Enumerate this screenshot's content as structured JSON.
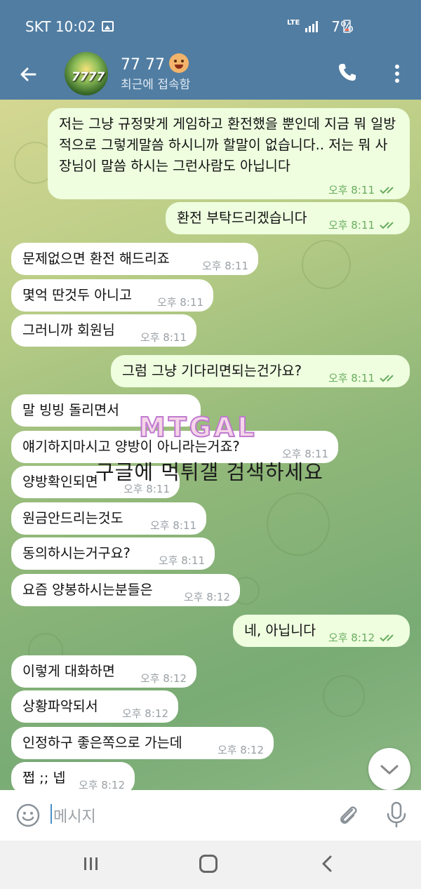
{
  "status_bar": {
    "carrier_time": "SKT 10:02",
    "network": "LTE",
    "battery": "7%"
  },
  "header": {
    "contact_name": "77 77",
    "status": "최근에 접속함",
    "avatar_text": "7777"
  },
  "messages": [
    {
      "dir": "out",
      "text": "저는 그냥 규정맞게 게임하고 환전했을 뿐인데 지금 뭐 일방적으로 그렇게말씀 하시니까 할말이 없습니다.. 저는 뭐 사장님이 말씀 하시는 그런사람도 아닙니다",
      "time": "오후 8:11"
    },
    {
      "dir": "out",
      "text": "환전 부탁드리겠습니다",
      "time": "오후 8:11"
    },
    {
      "dir": "in",
      "text": "문제없으면 환전 해드리죠",
      "time": "오후 8:11"
    },
    {
      "dir": "in",
      "text": "몇억 딴것두 아니고",
      "time": "오후 8:11"
    },
    {
      "dir": "in",
      "text": "그러니까 회원님",
      "time": "오후 8:11"
    },
    {
      "dir": "out",
      "text": "그럼 그냥 기다리면되는건가요?",
      "time": "오후 8:11"
    },
    {
      "dir": "in",
      "text": "말 빙빙 돌리면서",
      "time": ""
    },
    {
      "dir": "in",
      "text": "얘기하지마시고 양방이 아니라는거죠?",
      "time": "오후 8:11"
    },
    {
      "dir": "in",
      "text": "양방확인되면",
      "time": "오후 8:11"
    },
    {
      "dir": "in",
      "text": "원금안드리는것도",
      "time": "오후 8:11"
    },
    {
      "dir": "in",
      "text": "동의하시는거구요?",
      "time": "오후 8:11"
    },
    {
      "dir": "in",
      "text": "요즘 양봉하시는분들은",
      "time": "오후 8:12"
    },
    {
      "dir": "out",
      "text": "네, 아닙니다",
      "time": "오후 8:12"
    },
    {
      "dir": "in",
      "text": "이렇게 대화하면",
      "time": "오후 8:12"
    },
    {
      "dir": "in",
      "text": "상황파악되서",
      "time": "오후 8:12"
    },
    {
      "dir": "in",
      "text": "인정하구 좋은쪽으로 가는데",
      "time": "오후 8:12"
    },
    {
      "dir": "in",
      "text": "쩝 ;; 넵",
      "time": "오후 8:12"
    }
  ],
  "watermark": {
    "logo": "MTGAL",
    "text": "구글에 먹튀갤 검색하세요"
  },
  "input": {
    "placeholder": "메시지"
  },
  "icons": {
    "back": "arrow-left-icon",
    "call": "phone-icon",
    "more": "more-vertical-icon",
    "emoji": "smiley-icon",
    "attach": "paperclip-icon",
    "mic": "microphone-icon",
    "scroll": "chevron-down-icon"
  },
  "colors": {
    "header": "#517da2",
    "outgoing_bubble": "#eefedf",
    "incoming_bubble": "#ffffff",
    "read_check": "#6aac5f"
  }
}
